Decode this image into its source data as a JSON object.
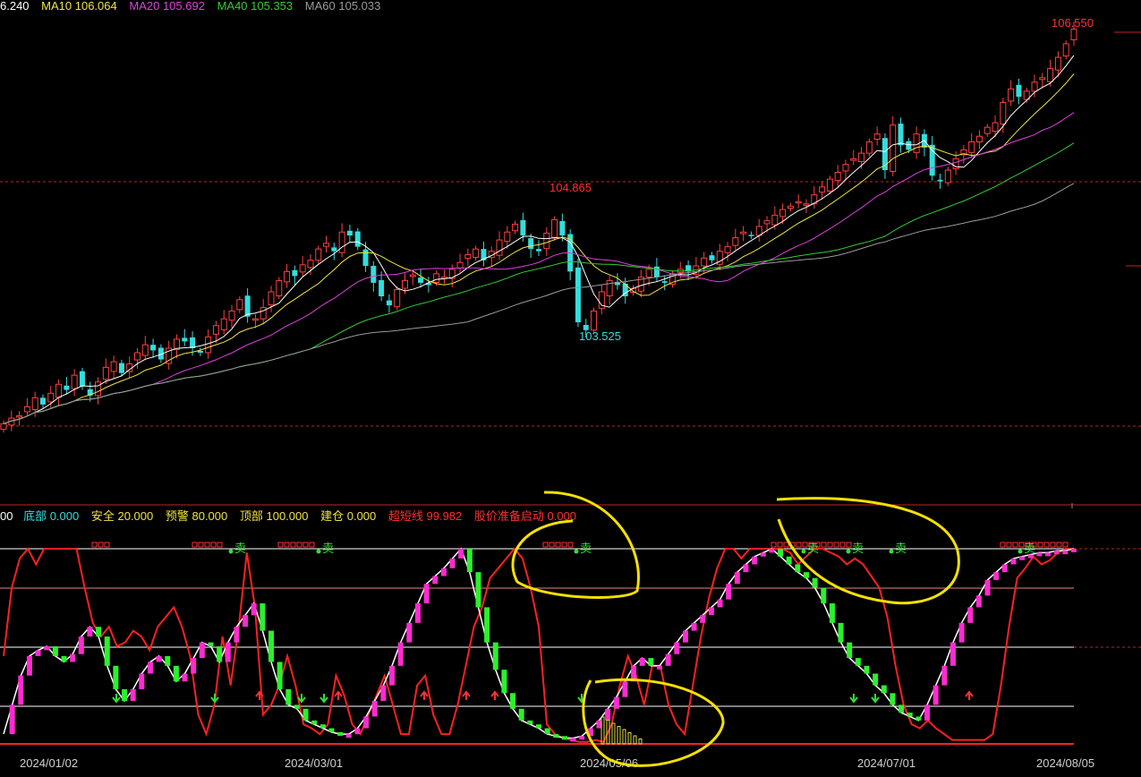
{
  "top_legend": [
    {
      "text": "6.240",
      "color": "#ffffff"
    },
    {
      "text": "MA10 106.064",
      "color": "#f0e442"
    },
    {
      "text": "MA20 105.692",
      "color": "#e040e0"
    },
    {
      "text": "MA40 105.353",
      "color": "#33cc33"
    },
    {
      "text": "MA60 105.033",
      "color": "#9a9a9a"
    }
  ],
  "bottom_legend": [
    {
      "text": "00",
      "color": "#ffffff"
    },
    {
      "text": "底部 0.000",
      "color": "#33dddd"
    },
    {
      "text": "安全 20.000",
      "color": "#f0e442"
    },
    {
      "text": "预警 80.000",
      "color": "#f0e442"
    },
    {
      "text": "顶部 100.000",
      "color": "#f0e442"
    },
    {
      "text": "建仓 0.000",
      "color": "#f0e442"
    },
    {
      "text": "超短线 99.982",
      "color": "#ff3030"
    },
    {
      "text": "股价准备启动 0.000",
      "color": "#ff3030"
    }
  ],
  "price_labels": {
    "high": "106.550",
    "mid_high": "104.865",
    "low": "103.525"
  },
  "date_labels": [
    "2024/01/02",
    "2024/03/01",
    "2024/05/06",
    "2024/07/01",
    "2024/08/05"
  ],
  "sell_marker": "卖",
  "chart_data": [
    {
      "type": "candlestick",
      "title": "",
      "x": [
        "2024/01/02",
        "2024/03/01",
        "2024/05/06",
        "2024/07/01",
        "2024/08/05"
      ],
      "price_axis": {
        "grid_levels": [
          106.3,
          105.3
        ]
      },
      "markers": {
        "max": 106.55,
        "local_high": 104.865,
        "local_low": 103.525
      },
      "close": [
        103.05,
        103.1,
        103.12,
        103.2,
        103.28,
        103.22,
        103.32,
        103.4,
        103.35,
        103.48,
        103.38,
        103.3,
        103.42,
        103.55,
        103.6,
        103.5,
        103.58,
        103.68,
        103.75,
        103.7,
        103.62,
        103.72,
        103.8,
        103.78,
        103.72,
        103.68,
        103.82,
        103.92,
        103.98,
        104.05,
        104.15,
        104.0,
        103.98,
        104.08,
        104.22,
        104.32,
        104.4,
        104.36,
        104.46,
        104.5,
        104.6,
        104.65,
        104.58,
        104.75,
        104.72,
        104.62,
        104.45,
        104.3,
        104.18,
        104.1,
        104.24,
        104.32,
        104.37,
        104.3,
        104.28,
        104.38,
        104.35,
        104.42,
        104.48,
        104.55,
        104.6,
        104.5,
        104.58,
        104.68,
        104.75,
        104.82,
        104.72,
        104.6,
        104.58,
        104.74,
        104.86,
        104.72,
        104.4,
        103.95,
        103.88,
        104.05,
        104.22,
        104.32,
        104.28,
        104.18,
        104.25,
        104.35,
        104.42,
        104.35,
        104.3,
        104.38,
        104.42,
        104.4,
        104.45,
        104.52,
        104.5,
        104.58,
        104.62,
        104.7,
        104.75,
        104.72,
        104.8,
        104.85,
        104.9,
        104.95,
        104.98,
        105.02,
        105.0,
        105.08,
        105.15,
        105.22,
        105.28,
        105.35,
        105.4,
        105.45,
        105.55,
        105.62,
        105.3,
        105.7,
        105.52,
        105.48,
        105.62,
        105.5,
        105.25,
        105.2,
        105.3,
        105.4,
        105.48,
        105.55,
        105.6,
        105.68,
        105.72,
        105.9,
        106.02,
        105.95,
        106.0,
        106.08,
        106.12,
        106.2,
        106.3,
        106.42,
        106.55
      ]
    },
    {
      "type": "line",
      "title": "",
      "y_levels": {
        "底部": 0,
        "安全": 20,
        "预警": 80,
        "顶部": 100,
        "建仓": 0,
        "超短线": 99.982,
        "股价准备启动": 0
      },
      "ylim": [
        0,
        100
      ],
      "series": [
        {
          "name": "超短线",
          "color": "#ff2020",
          "values": [
            45,
            80,
            95,
            100,
            92,
            100,
            100,
            100,
            100,
            100,
            80,
            62,
            55,
            60,
            50,
            52,
            58,
            55,
            48,
            60,
            65,
            70,
            60,
            45,
            15,
            5,
            20,
            55,
            30,
            60,
            98,
            70,
            15,
            20,
            30,
            45,
            30,
            10,
            8,
            5,
            10,
            35,
            25,
            10,
            5,
            15,
            25,
            35,
            20,
            5,
            5,
            30,
            35,
            15,
            5,
            5,
            20,
            40,
            60,
            70,
            85,
            90,
            95,
            100,
            95,
            80,
            60,
            10,
            5,
            3,
            2,
            1,
            1,
            2,
            1,
            10,
            30,
            45,
            35,
            20,
            40,
            40,
            20,
            10,
            5,
            30,
            55,
            75,
            90,
            100,
            100,
            95,
            100,
            100,
            100,
            100,
            100,
            98,
            92,
            96,
            100,
            100,
            98,
            96,
            92,
            95,
            92,
            86,
            80,
            65,
            40,
            20,
            10,
            8,
            12,
            8,
            5,
            2,
            2,
            2,
            2,
            2,
            5,
            30,
            60,
            85,
            90,
            96,
            92,
            94,
            98,
            100,
            99.982
          ]
        },
        {
          "name": "股价准备启动",
          "color": "#ffffff",
          "values": [
            5,
            20,
            35,
            45,
            48,
            50,
            45,
            42,
            46,
            55,
            60,
            55,
            40,
            28,
            22,
            28,
            36,
            42,
            45,
            40,
            32,
            36,
            44,
            52,
            50,
            42,
            52,
            60,
            66,
            72,
            58,
            42,
            28,
            20,
            18,
            12,
            10,
            8,
            6,
            5,
            5,
            8,
            14,
            22,
            30,
            40,
            52,
            62,
            72,
            82,
            86,
            90,
            95,
            100,
            88,
            70,
            52,
            38,
            26,
            18,
            12,
            10,
            8,
            5,
            4,
            3,
            3,
            4,
            8,
            12,
            18,
            24,
            32,
            40,
            44,
            40,
            40,
            46,
            52,
            58,
            62,
            66,
            70,
            74,
            82,
            88,
            92,
            96,
            98,
            100,
            96,
            92,
            88,
            85,
            80,
            72,
            62,
            52,
            44,
            40,
            36,
            30,
            26,
            20,
            16,
            14,
            12,
            20,
            30,
            40,
            52,
            62,
            70,
            76,
            84,
            88,
            92,
            95,
            96,
            97,
            98,
            98,
            99,
            99,
            100
          ]
        }
      ]
    }
  ]
}
